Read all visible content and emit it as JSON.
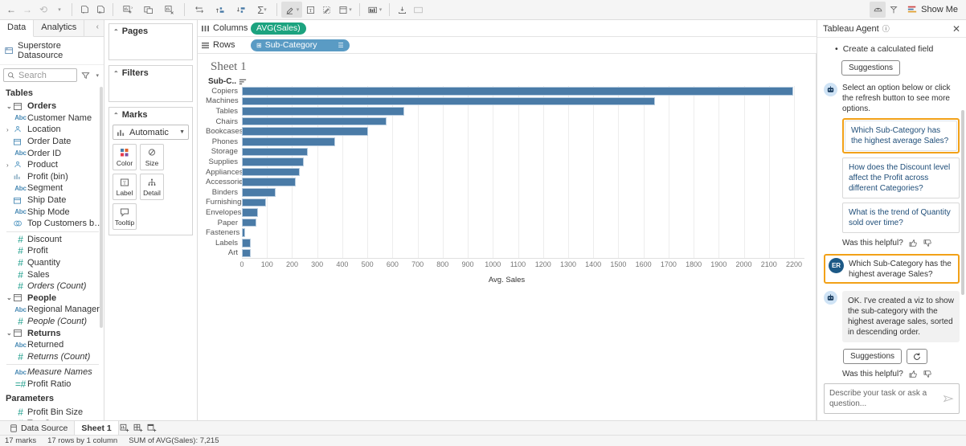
{
  "toolbar": {
    "back_icon": "back-arrow-icon",
    "forward_icon": "forward-arrow-icon",
    "undo_icon": "undo-icon",
    "save_icon": "save-icon",
    "pause_icon": "pause-auto-update-icon",
    "new_worksheet_icon": "new-worksheet-icon",
    "duplicate_icon": "duplicate-icon",
    "clear_icon": "clear-sheet-icon",
    "swap_icon": "swap-rows-columns-icon",
    "sort_asc_icon": "sort-ascending-icon",
    "sort_desc_icon": "sort-descending-icon",
    "totals_icon": "totals-icon",
    "highlight_icon": "highlighter-icon",
    "text_icon": "text-annotation-icon",
    "edit_icon": "edit-icon",
    "card_icon": "show-hide-cards-icon",
    "fit_icon": "fit-selector-icon",
    "download_icon": "download-icon",
    "presentation_icon": "presentation-mode-icon",
    "agent_icon": "tableau-agent-icon",
    "pin_icon": "pin-icon",
    "show_me_icon": "show-me-icon",
    "show_me_label": "Show Me"
  },
  "data_pane": {
    "tabs": [
      {
        "label": "Data",
        "selected": true
      },
      {
        "label": "Analytics",
        "selected": false
      }
    ],
    "collapse_icon": "collapse-chevron-icon",
    "datasource": {
      "icon": "datasource-icon",
      "label": "Superstore Datasource"
    },
    "search": {
      "placeholder": "Search",
      "icon": "search-icon"
    },
    "filter_icon": "filter-icon",
    "menu_icon": "caret-down-icon",
    "sections": [
      {
        "header": "Tables",
        "fields": [
          {
            "caret": "⌄",
            "type": "table",
            "name": "Orders",
            "bold": true
          },
          {
            "type": "Abc",
            "name": "Customer Name"
          },
          {
            "caret": "›",
            "type": "geo",
            "name": "Location"
          },
          {
            "type": "date",
            "name": "Order Date"
          },
          {
            "type": "Abc",
            "name": "Order ID"
          },
          {
            "caret": "›",
            "type": "geo",
            "name": "Product"
          },
          {
            "type": "bin",
            "name": "Profit (bin)"
          },
          {
            "type": "Abc",
            "name": "Segment"
          },
          {
            "type": "date",
            "name": "Ship Date"
          },
          {
            "type": "Abc",
            "name": "Ship Mode"
          },
          {
            "type": "set",
            "name": "Top Customers by P..."
          },
          {
            "separator": true
          },
          {
            "type": "num",
            "name": "Discount"
          },
          {
            "type": "num",
            "name": "Profit"
          },
          {
            "type": "num",
            "name": "Quantity"
          },
          {
            "type": "num",
            "name": "Sales"
          },
          {
            "type": "num",
            "name": "Orders (Count)",
            "italic": true
          },
          {
            "caret": "⌄",
            "type": "table",
            "name": "People",
            "bold": true
          },
          {
            "type": "Abc",
            "name": "Regional Manager"
          },
          {
            "type": "num",
            "name": "People (Count)",
            "italic": true
          },
          {
            "caret": "⌄",
            "type": "table",
            "name": "Returns",
            "bold": true
          },
          {
            "type": "Abc",
            "name": "Returned"
          },
          {
            "type": "num",
            "name": "Returns (Count)",
            "italic": true
          },
          {
            "separator": true
          },
          {
            "type": "Abc",
            "name": "Measure Names",
            "italic": true
          },
          {
            "type": "calc",
            "name": "Profit Ratio"
          }
        ]
      },
      {
        "header": "Parameters",
        "fields": [
          {
            "type": "num",
            "name": "Profit Bin Size"
          },
          {
            "type": "num",
            "name": "Top Customers"
          }
        ]
      }
    ]
  },
  "shelves": {
    "pages": {
      "label": "Pages",
      "chevron": "⌃"
    },
    "filters": {
      "label": "Filters",
      "chevron": "⌃"
    },
    "marks": {
      "label": "Marks",
      "chevron": "⌃",
      "mark_type": "Automatic",
      "mark_type_icon": "bar-chart-icon",
      "buttons": [
        {
          "label": "Color",
          "icon": "color-icon"
        },
        {
          "label": "Size",
          "icon": "size-icon"
        },
        {
          "label": "Label",
          "icon": "label-icon"
        },
        {
          "label": "Detail",
          "icon": "detail-icon"
        },
        {
          "label": "Tooltip",
          "icon": "tooltip-icon"
        }
      ]
    },
    "columns": {
      "label": "Columns",
      "icon": "columns-icon",
      "pill": "AVG(Sales)",
      "pill_color": "#1ca37f"
    },
    "rows": {
      "label": "Rows",
      "icon": "rows-icon",
      "pill": "Sub-Category",
      "pill_color": "#5a9bc4",
      "pill_icon": "⊞"
    }
  },
  "viz": {
    "sheet_title": "Sheet 1",
    "row_header": "Sub-C..",
    "sort_icon": "sort-descending-icon"
  },
  "chart_data": {
    "type": "bar",
    "title": "Sheet 1",
    "orientation": "horizontal",
    "xlabel": "Avg. Sales",
    "ylabel": "Sub-Category",
    "xlim": [
      0,
      2200
    ],
    "xticks": [
      0,
      100,
      200,
      300,
      400,
      500,
      600,
      700,
      800,
      900,
      1000,
      1100,
      1200,
      1300,
      1400,
      1500,
      1600,
      1700,
      1800,
      1900,
      2000,
      2100,
      2200
    ],
    "grid": true,
    "legend": "none",
    "bar_color": "#4a7ba7",
    "categories": [
      "Copiers",
      "Machines",
      "Tables",
      "Chairs",
      "Bookcases",
      "Phones",
      "Storage",
      "Supplies",
      "Appliances",
      "Accessories",
      "Binders",
      "Furnishings",
      "Envelopes",
      "Paper",
      "Fasteners",
      "Labels",
      "Art"
    ],
    "values": [
      2198,
      1645,
      648,
      577,
      504,
      371,
      264,
      246,
      230,
      216,
      134,
      95,
      64,
      58,
      14,
      34,
      34
    ]
  },
  "agent": {
    "title": "Tableau Agent",
    "info_icon": "info-icon",
    "close_icon": "close-icon",
    "bullet_item": "Create a calculated field",
    "suggestions_label": "Suggestions",
    "bot_prompt": "Select an option below or click the refresh button to see more options.",
    "options": [
      {
        "text": "Which Sub-Category has the highest average Sales?",
        "highlighted": true
      },
      {
        "text": "How does the Discount level affect the Profit across different Categories?",
        "highlighted": false
      },
      {
        "text": "What is the trend of Quantity sold over time?",
        "highlighted": false
      }
    ],
    "helpful_label": "Was this helpful?",
    "thumbs_up_icon": "thumbs-up-icon",
    "thumbs_down_icon": "thumbs-down-icon",
    "user_initials": "ER",
    "user_question": "Which Sub-Category has the highest average Sales?",
    "bot_response": "OK. I've created a viz to show the sub-category with the highest average sales, sorted in descending order.",
    "refresh_icon": "refresh-icon",
    "input_placeholder": "Describe your task or ask a question...",
    "send_icon": "send-icon",
    "highlight_color": "#f2a118"
  },
  "bottom": {
    "tabs": [
      {
        "label": "Data Source",
        "icon": "datasource-tab-icon",
        "selected": false
      },
      {
        "label": "Sheet 1",
        "icon": "",
        "selected": true
      }
    ],
    "new_sheet_icon": "new-worksheet-tab-icon",
    "new_dashboard_icon": "new-dashboard-tab-icon",
    "new_story_icon": "new-story-tab-icon",
    "status": [
      "17 marks",
      "17 rows by 1 column",
      "SUM of AVG(Sales): 7,215"
    ]
  }
}
